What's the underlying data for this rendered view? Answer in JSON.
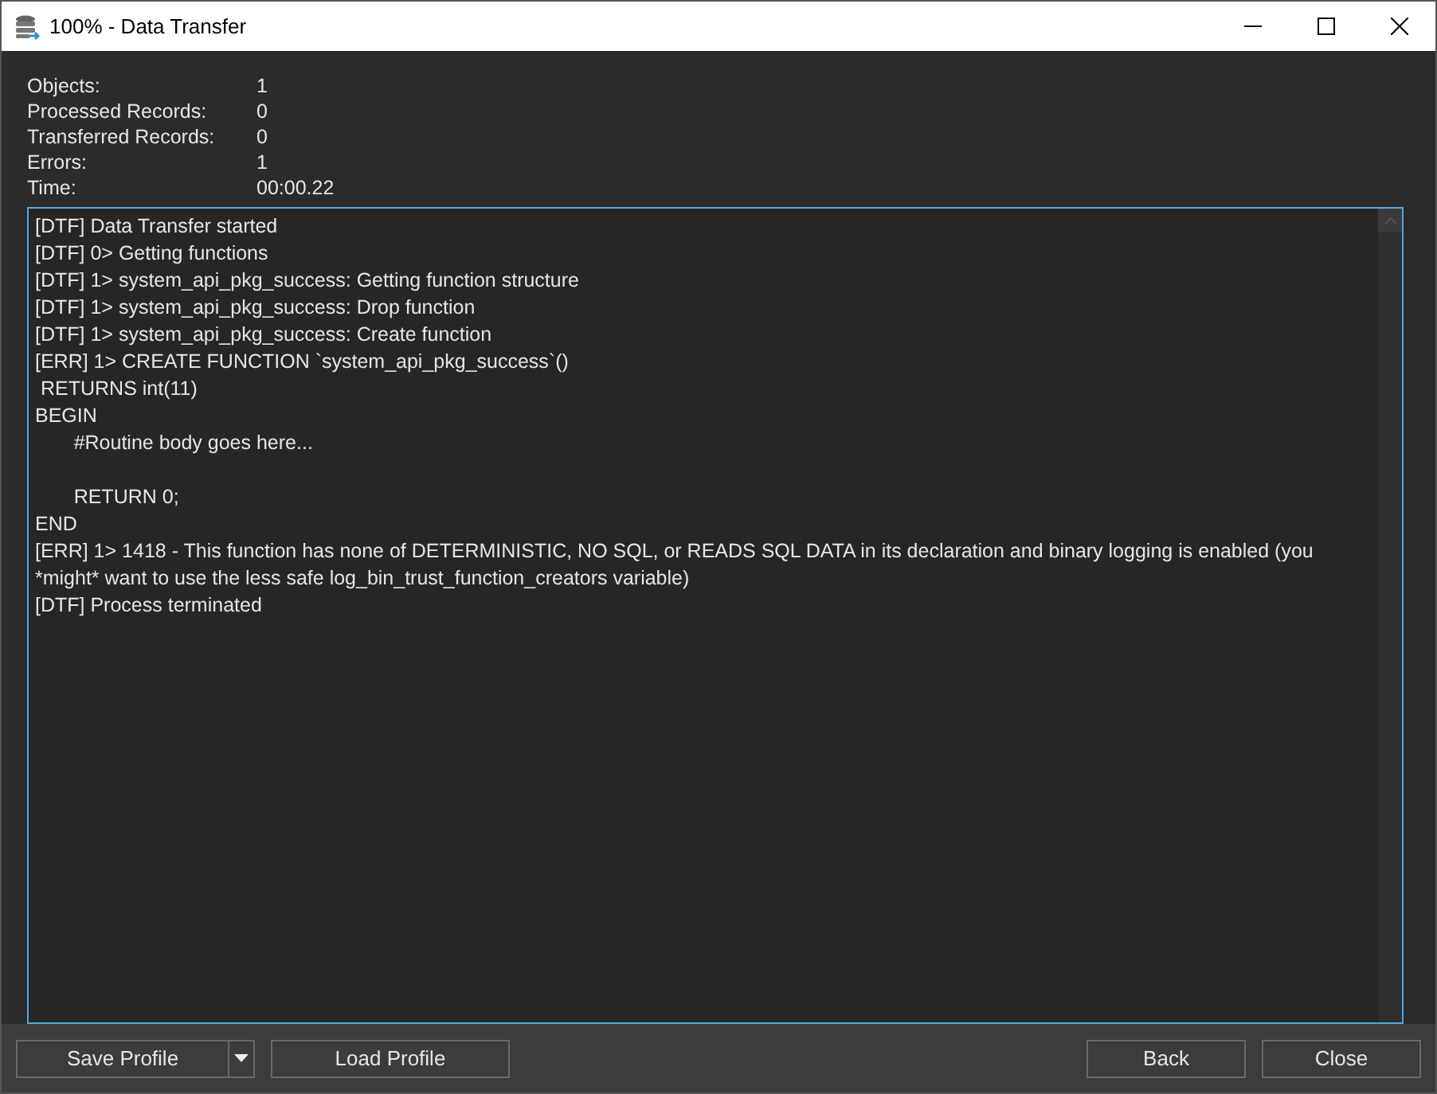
{
  "window": {
    "title": "100% - Data Transfer"
  },
  "stats": [
    {
      "label": "Objects:",
      "value": "1"
    },
    {
      "label": "Processed Records:",
      "value": "0"
    },
    {
      "label": "Transferred Records:",
      "value": "0"
    },
    {
      "label": "Errors:",
      "value": "1"
    },
    {
      "label": "Time:",
      "value": "00:00.22"
    }
  ],
  "log_blocks": [
    {
      "lines": [
        "[DTF] Data Transfer started",
        "[DTF] 0> Getting functions",
        "[DTF] 1> system_api_pkg_success: Getting function structure",
        "[DTF] 1> system_api_pkg_success: Drop function",
        "[DTF] 1> system_api_pkg_success: Create function",
        "[ERR] 1> CREATE FUNCTION `system_api_pkg_success`()",
        " RETURNS int(11)",
        "BEGIN",
        "\t#Routine body goes here..."
      ]
    },
    {
      "lines": [
        "\tRETURN 0;",
        "END",
        "[ERR] 1> 1418 - This function has none of DETERMINISTIC, NO SQL, or READS SQL DATA in its declaration and binary logging is enabled (you *might* want to use the less safe log_bin_trust_function_creators variable)",
        "[DTF] Process terminated"
      ]
    }
  ],
  "buttons_left": [
    {
      "label": "Save Profile",
      "kind": "split"
    },
    {
      "label": "Load Profile",
      "kind": "plain"
    }
  ],
  "buttons_right": [
    {
      "label": "Back",
      "kind": "plain"
    },
    {
      "label": "Close",
      "kind": "plain"
    }
  ]
}
